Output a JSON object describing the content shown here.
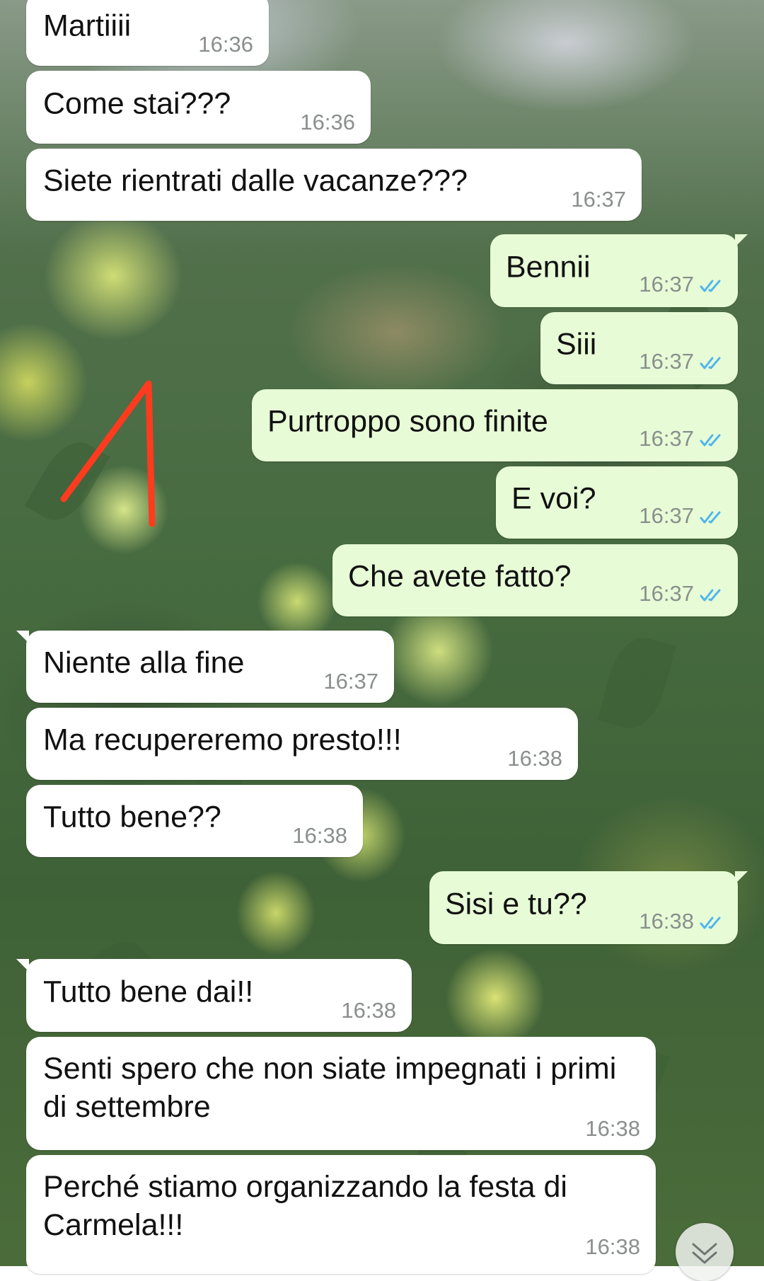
{
  "messages": [
    {
      "dir": "in",
      "text": "Martiiii",
      "time": "16:36"
    },
    {
      "dir": "in",
      "text": "Come stai???",
      "time": "16:36"
    },
    {
      "dir": "in",
      "text": "Siete rientrati dalle vacanze???",
      "time": "16:37"
    },
    {
      "dir": "out",
      "text": "Bennii",
      "time": "16:37",
      "status": "read"
    },
    {
      "dir": "out",
      "text": "Siii",
      "time": "16:37",
      "status": "read"
    },
    {
      "dir": "out",
      "text": "Purtroppo sono finite",
      "time": "16:37",
      "status": "read"
    },
    {
      "dir": "out",
      "text": "E voi?",
      "time": "16:37",
      "status": "read"
    },
    {
      "dir": "out",
      "text": "Che avete fatto?",
      "time": "16:37",
      "status": "read"
    },
    {
      "dir": "in",
      "text": "Niente alla fine",
      "time": "16:37"
    },
    {
      "dir": "in",
      "text": "Ma recupereremo presto!!!",
      "time": "16:38"
    },
    {
      "dir": "in",
      "text": "Tutto bene??",
      "time": "16:38"
    },
    {
      "dir": "out",
      "text": "Sisi e tu??",
      "time": "16:38",
      "status": "read"
    },
    {
      "dir": "in",
      "text": "Tutto bene dai!!",
      "time": "16:38"
    },
    {
      "dir": "in",
      "text": "Senti spero che non siate impegnati i primi di settembre",
      "time": "16:38"
    },
    {
      "dir": "in",
      "text": "Perché stiamo organizzando la festa di Carmela!!!",
      "time": "16:38"
    }
  ],
  "colors": {
    "incoming_bubble": "#ffffff",
    "outgoing_bubble": "#e7fcd6",
    "read_ticks": "#4fb6ec",
    "annotation_arrow": "#ff3b1f"
  },
  "icons": {
    "read_status": "double-check-icon",
    "scroll_down": "chevron-down-double-icon"
  }
}
